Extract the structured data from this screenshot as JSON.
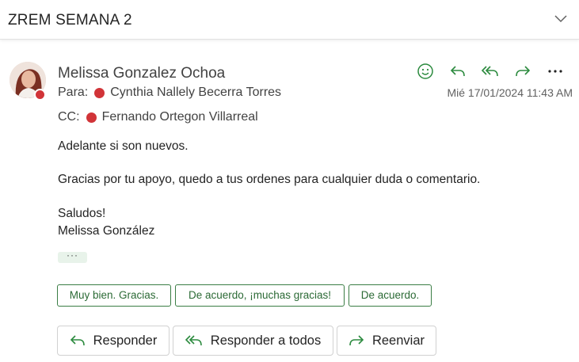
{
  "header": {
    "subject": "ZREM SEMANA 2"
  },
  "message": {
    "sender": "Melissa Gonzalez Ochoa",
    "to_label": "Para:",
    "to_name": "Cynthia Nallely Becerra Torres",
    "cc_label": "CC:",
    "cc_name": "Fernando Ortegon Villarreal",
    "date": "Mié 17/01/2024 11:43 AM",
    "body": {
      "line1": "Adelante si son nuevos.",
      "line2": "Gracias por tu apoyo, quedo a tus ordenes para cualquier duda o comentario.",
      "line3": "Saludos!",
      "line4": "Melissa González"
    },
    "more": "···"
  },
  "suggested_replies": [
    "Muy bien. Gracias.",
    "De acuerdo, ¡muchas gracias!",
    "De acuerdo."
  ],
  "buttons": {
    "reply": "Responder",
    "reply_all": "Responder a todos",
    "forward": "Reenviar"
  },
  "icons": {
    "react": "emoji-icon",
    "reply": "reply-icon",
    "reply_all": "reply-all-icon",
    "forward": "forward-icon",
    "more": "more-icon"
  },
  "colors": {
    "accent": "#2b8a3e",
    "presence": "#d13438",
    "chip_border": "#3a7d44"
  }
}
